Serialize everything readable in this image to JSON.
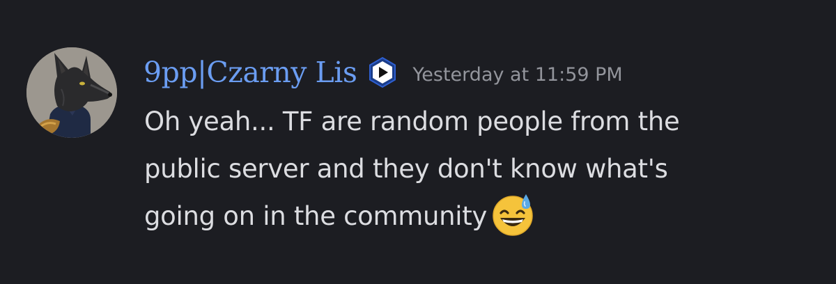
{
  "message": {
    "username": "9pp|Czarny Lis",
    "timestamp": "Yesterday at 11:59 PM",
    "content_lines": [
      "Oh yeah... TF are random people from the",
      "public server and they don't know what's",
      "going on in the community"
    ],
    "emoji": "sweat-smile-icon",
    "badge": "play-badge-icon",
    "avatar": "fox-avatar"
  },
  "colors": {
    "background": "#1c1d22",
    "username": "#6b9df2",
    "timestamp": "#93959c",
    "text": "#dcdde1"
  }
}
